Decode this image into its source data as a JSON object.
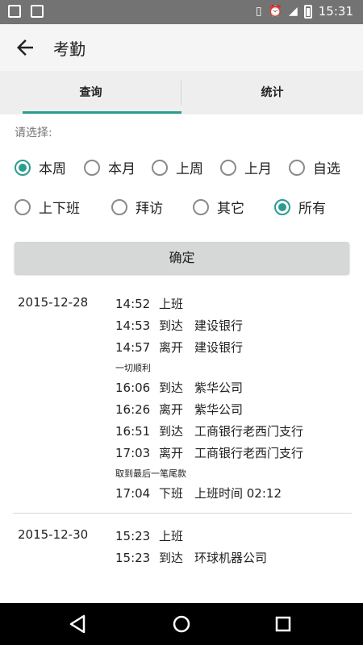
{
  "status_bar": {
    "time": "15:31"
  },
  "toolbar": {
    "title": "考勤"
  },
  "tabs": [
    {
      "label": "查询"
    },
    {
      "label": "统计"
    }
  ],
  "filter": {
    "prompt": "请选择:",
    "period_options": [
      {
        "label": "本周",
        "checked": true
      },
      {
        "label": "本月",
        "checked": false
      },
      {
        "label": "上周",
        "checked": false
      },
      {
        "label": "上月",
        "checked": false
      },
      {
        "label": "自选",
        "checked": false
      }
    ],
    "type_options": [
      {
        "label": "上下班",
        "checked": false
      },
      {
        "label": "拜访",
        "checked": false
      },
      {
        "label": "其它",
        "checked": false
      },
      {
        "label": "所有",
        "checked": true
      }
    ]
  },
  "confirm_button": {
    "label": "确定"
  },
  "records": [
    {
      "date": "2015-12-28",
      "events": [
        {
          "time": "14:52",
          "action": "上班",
          "detail": ""
        },
        {
          "time": "14:53",
          "action": "到达",
          "detail": "建设银行"
        },
        {
          "time": "14:57",
          "action": "离开",
          "detail": "建设银行"
        },
        {
          "note": "一切顺利"
        },
        {
          "time": "16:06",
          "action": "到达",
          "detail": "紫华公司"
        },
        {
          "time": "16:26",
          "action": "离开",
          "detail": "紫华公司"
        },
        {
          "time": "16:51",
          "action": "到达",
          "detail": "工商银行老西门支行"
        },
        {
          "time": "17:03",
          "action": "离开",
          "detail": "工商银行老西门支行"
        },
        {
          "note": "取到最后一笔尾款"
        },
        {
          "time": "17:04",
          "action": "下班",
          "detail": "上班时间 02:12"
        }
      ]
    },
    {
      "date": "2015-12-30",
      "events": [
        {
          "time": "15:23",
          "action": "上班",
          "detail": ""
        },
        {
          "time": "15:23",
          "action": "到达",
          "detail": "环球机器公司"
        }
      ]
    }
  ],
  "colors": {
    "accent": "#2a9d8f",
    "status_bar": "#737373",
    "nav_bar": "#000000"
  }
}
